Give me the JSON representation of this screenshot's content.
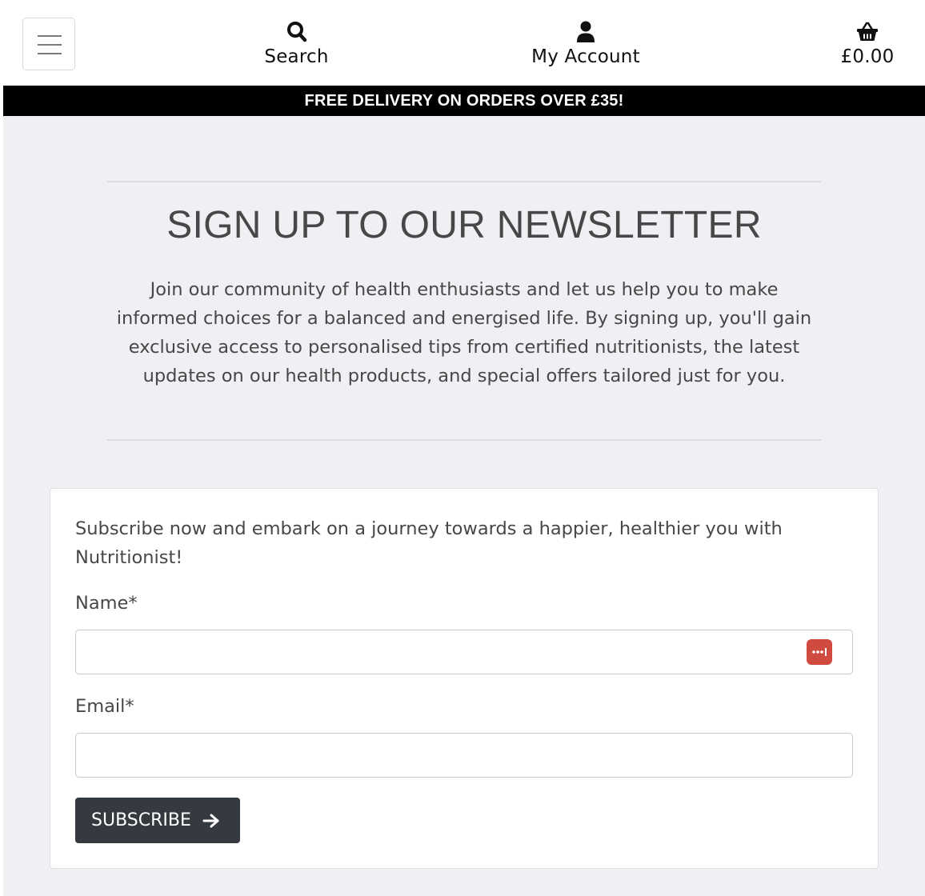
{
  "header": {
    "menu_icon": "hamburger-icon",
    "search": {
      "icon": "search-icon",
      "label": "Search"
    },
    "account": {
      "icon": "user-icon",
      "label": "My Account"
    },
    "basket": {
      "icon": "basket-icon",
      "total": "£0.00"
    }
  },
  "promo_banner": "FREE DELIVERY ON ORDERS OVER £35!",
  "newsletter": {
    "heading": "SIGN UP TO OUR NEWSLETTER",
    "intro": "Join our community of health enthusiasts and let us help you to make informed choices for a balanced and energised life. By signing up, you'll gain exclusive access to personalised tips from certified nutritionists, the latest updates on our health products, and special offers tailored just for you."
  },
  "form": {
    "text": "Subscribe now and embark on a journey towards a happier, healthier you with Nutritionist!",
    "name_label": "Name*",
    "name_value": "",
    "email_label": "Email*",
    "email_value": "",
    "password_manager_icon": "password-manager-icon",
    "submit_label": "SUBSCRIBE",
    "submit_icon": "arrow-right-icon"
  },
  "colors": {
    "page_background": "#eff0f3",
    "banner_background": "#000000",
    "button_background": "#343a40",
    "text": "#474747",
    "password_badge": "#cf4b40"
  }
}
